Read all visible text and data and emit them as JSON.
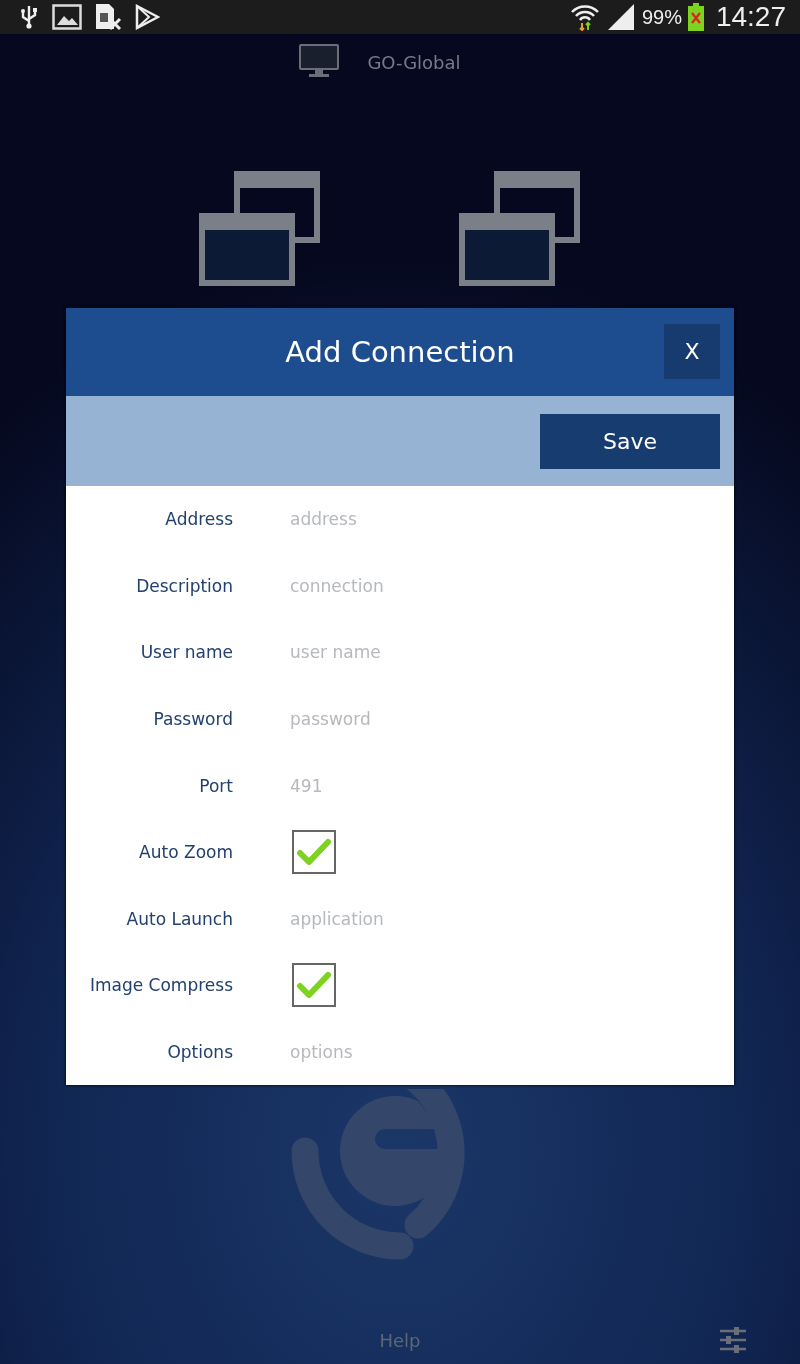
{
  "status_bar": {
    "battery": "99%",
    "time": "14:27"
  },
  "app_bar": {
    "title": "GO-Global"
  },
  "dialog": {
    "title": "Add Connection",
    "close": "X",
    "save": "Save",
    "fields": [
      {
        "label": "Address",
        "kind": "text",
        "placeholder": "address"
      },
      {
        "label": "Description",
        "kind": "text",
        "placeholder": "connection"
      },
      {
        "label": "User name",
        "kind": "text",
        "placeholder": "user name"
      },
      {
        "label": "Password",
        "kind": "text",
        "placeholder": "password"
      },
      {
        "label": "Port",
        "kind": "text",
        "placeholder": "491"
      },
      {
        "label": "Auto Zoom",
        "kind": "checkbox",
        "checked": true
      },
      {
        "label": "Auto Launch",
        "kind": "text",
        "placeholder": "application"
      },
      {
        "label": "Image Compress",
        "kind": "checkbox",
        "checked": true
      },
      {
        "label": "Options",
        "kind": "text",
        "placeholder": "options"
      }
    ]
  },
  "footer": {
    "help": "Help"
  }
}
